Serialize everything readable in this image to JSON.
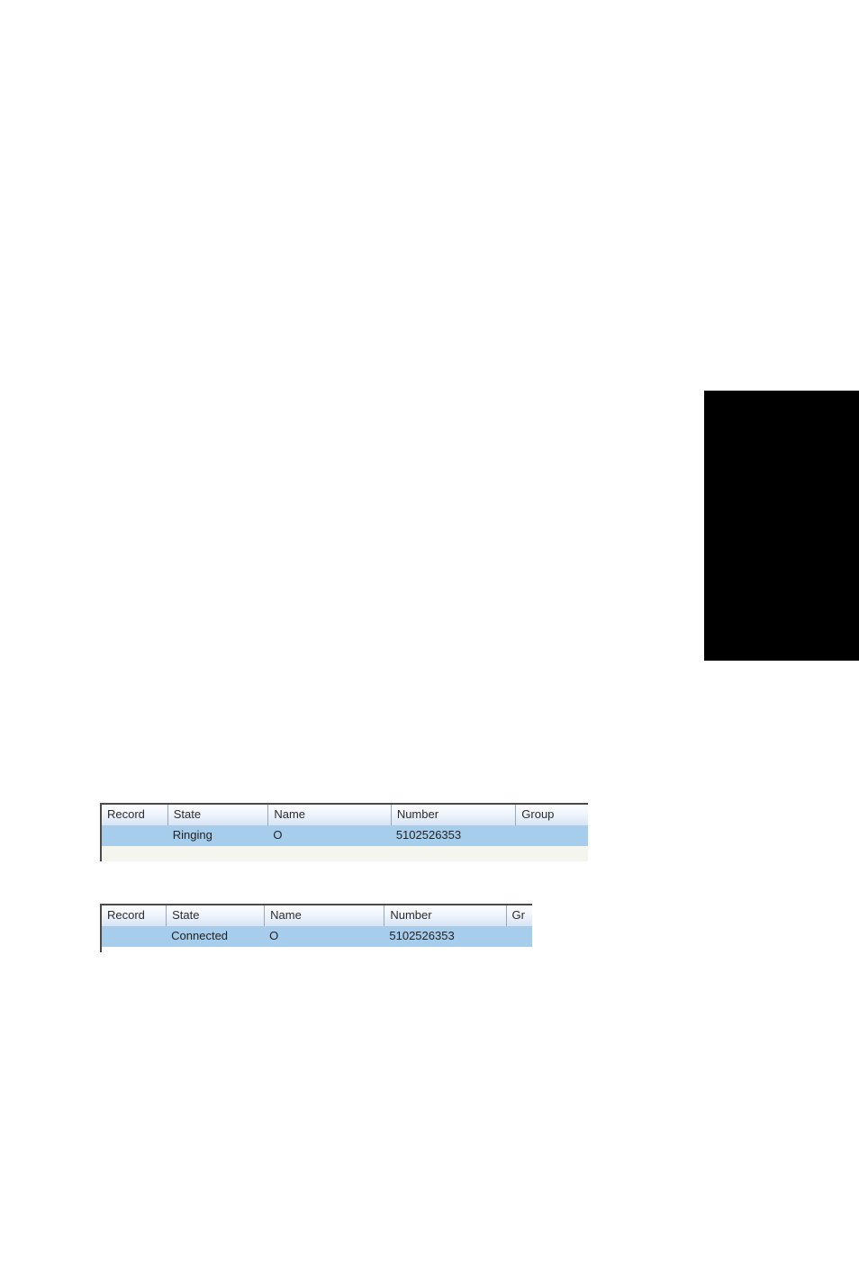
{
  "tables": [
    {
      "headers": {
        "record": "Record",
        "state": "State",
        "name": "Name",
        "number": "Number",
        "group": "Group"
      },
      "row": {
        "record": "",
        "state": "Ringing",
        "name": "O",
        "number": "5102526353",
        "group": ""
      }
    },
    {
      "headers": {
        "record": "Record",
        "state": "State",
        "name": "Name",
        "number": "Number",
        "group": "Gr"
      },
      "row": {
        "record": "",
        "state": "Connected",
        "name": "O",
        "number": "5102526353",
        "group": ""
      }
    }
  ]
}
